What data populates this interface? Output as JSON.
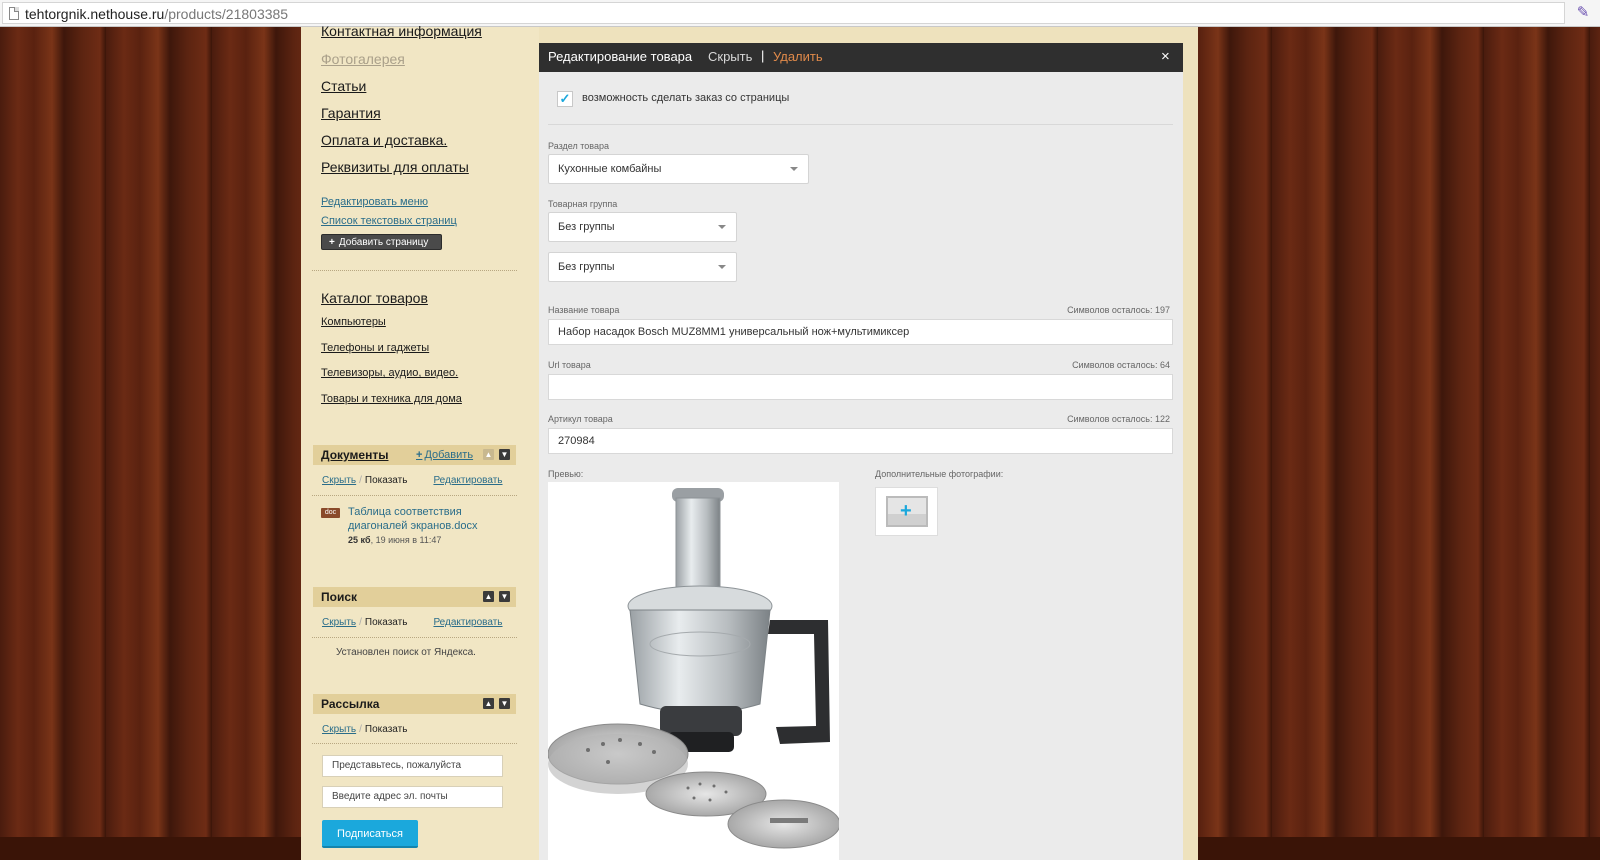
{
  "browser": {
    "url_host": "tehtorgnik.nethouse.ru",
    "url_path": "/products/21803385"
  },
  "sidebar": {
    "menu": [
      {
        "label": "Контактная информация",
        "faded": false
      },
      {
        "label": "Фотогалерея",
        "faded": true
      },
      {
        "label": "Статьи",
        "faded": false
      },
      {
        "label": "Гарантия",
        "faded": false
      },
      {
        "label": "Оплата и доставка.",
        "faded": false
      },
      {
        "label": "Реквизиты для оплаты",
        "faded": false
      }
    ],
    "edit_menu": "Редактировать меню",
    "text_pages_list": "Список текстовых страниц",
    "add_page_button": "Добавить страницу",
    "catalog": {
      "title": "Каталог товаров",
      "items": [
        "Компьютеры",
        "Телефоны и гаджеты",
        "Телевизоры, аудио, видео.",
        "Товары и техника для дома"
      ]
    },
    "documents": {
      "title": "Документы",
      "add_label": "Добавить",
      "hide": "Скрыть",
      "show": "Показать",
      "edit": "Редактировать",
      "doc_badge": "doc",
      "doc_name": "Таблица соответствия диагоналей экранов.docx",
      "doc_size": "25 кб",
      "doc_date": ", 19 июня в 11:47"
    },
    "search": {
      "title": "Поиск",
      "hide": "Скрыть",
      "show": "Показать",
      "edit": "Редактировать",
      "info": "Установлен поиск от Яндекса."
    },
    "newsletter": {
      "title": "Рассылка",
      "hide": "Скрыть",
      "show": "Показать",
      "name_placeholder": "Представьтесь, пожалуйста",
      "email_placeholder": "Введите адрес эл. почты",
      "subscribe_button": "Подписаться"
    }
  },
  "editor": {
    "title": "Редактирование товара",
    "hide": "Скрыть",
    "separator": "|",
    "delete": "Удалить",
    "close": "×",
    "order_checkbox_label": "возможность сделать заказ со страницы",
    "order_checkbox_checked": true,
    "section_label": "Раздел товара",
    "section_value": "Кухонные комбайны",
    "group_label": "Товарная группа",
    "group_value_1": "Без группы",
    "group_value_2": "Без группы",
    "name_label": "Название товара",
    "name_chars_left": "Символов осталось: 197",
    "name_value": "Набор насадок Bosch MUZ8MM1 универсальный нож+мультимиксер",
    "url_label": "Url товара",
    "url_chars_left": "Символов осталось: 64",
    "url_value": "",
    "sku_label": "Артикул товара",
    "sku_chars_left": "Символов осталось: 122",
    "sku_value": "270984",
    "preview_label": "Превью:",
    "extra_photos_label": "Дополнительные фотографии:"
  },
  "colors": {
    "accent": "#1ba8dc",
    "delete": "#e08a4a",
    "editor_header": "#2f2f2f"
  }
}
